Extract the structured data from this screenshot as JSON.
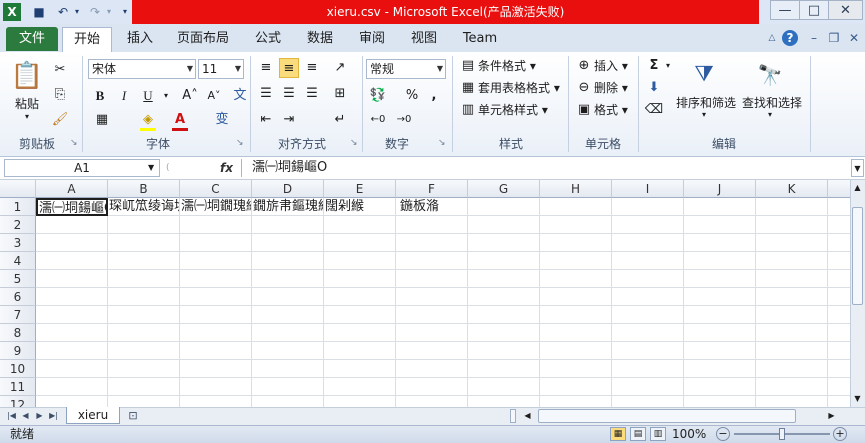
{
  "window": {
    "title": "xieru.csv - Microsoft Excel(产品激活失败)",
    "app_icon": "X",
    "minimize": "—",
    "restore": "□",
    "close": "✕"
  },
  "tabs": {
    "file": "文件",
    "items": [
      "开始",
      "插入",
      "页面布局",
      "公式",
      "数据",
      "审阅",
      "视图",
      "Team"
    ]
  },
  "ribbon": {
    "clipboard": {
      "label": "剪贴板",
      "paste": "粘贴"
    },
    "font": {
      "label": "字体",
      "font_name": "宋体",
      "font_size": "11",
      "bold": "B",
      "italic": "I",
      "underline": "U"
    },
    "alignment": {
      "label": "对齐方式"
    },
    "number": {
      "label": "数字",
      "format": "常规",
      "percent": "%",
      "comma": ","
    },
    "styles": {
      "label": "样式",
      "conditional": "条件格式",
      "table": "套用表格格式",
      "cell_styles": "单元格样式"
    },
    "cells": {
      "label": "单元格",
      "insert": "插入",
      "delete": "删除",
      "format": "格式"
    },
    "editing": {
      "label": "编辑",
      "sort": "排序和筛选",
      "find": "查找和选择"
    }
  },
  "formula_bar": {
    "name_box": "A1",
    "fx": "fx",
    "content": "濡㈠垌鍚嶇О"
  },
  "grid": {
    "columns": [
      "A",
      "B",
      "C",
      "D",
      "E",
      "F",
      "G",
      "H",
      "I",
      "J",
      "K"
    ],
    "rows": [
      "1",
      "2",
      "3",
      "4",
      "5",
      "6",
      "7",
      "8",
      "9",
      "10",
      "11",
      "12"
    ],
    "row1": [
      "濡㈠垌鍚嶇О",
      "琛屼笟绫诲埆",
      "濡㈠垌鐗瑰緛",
      "鐗旂帇鏂瑰紡",
      "闊剁緱",
      "鍦板潃",
      "",
      "",
      "",
      "",
      ""
    ]
  },
  "sheets": {
    "active": "xieru"
  },
  "status": {
    "ready": "就绪",
    "zoom": "100%"
  }
}
